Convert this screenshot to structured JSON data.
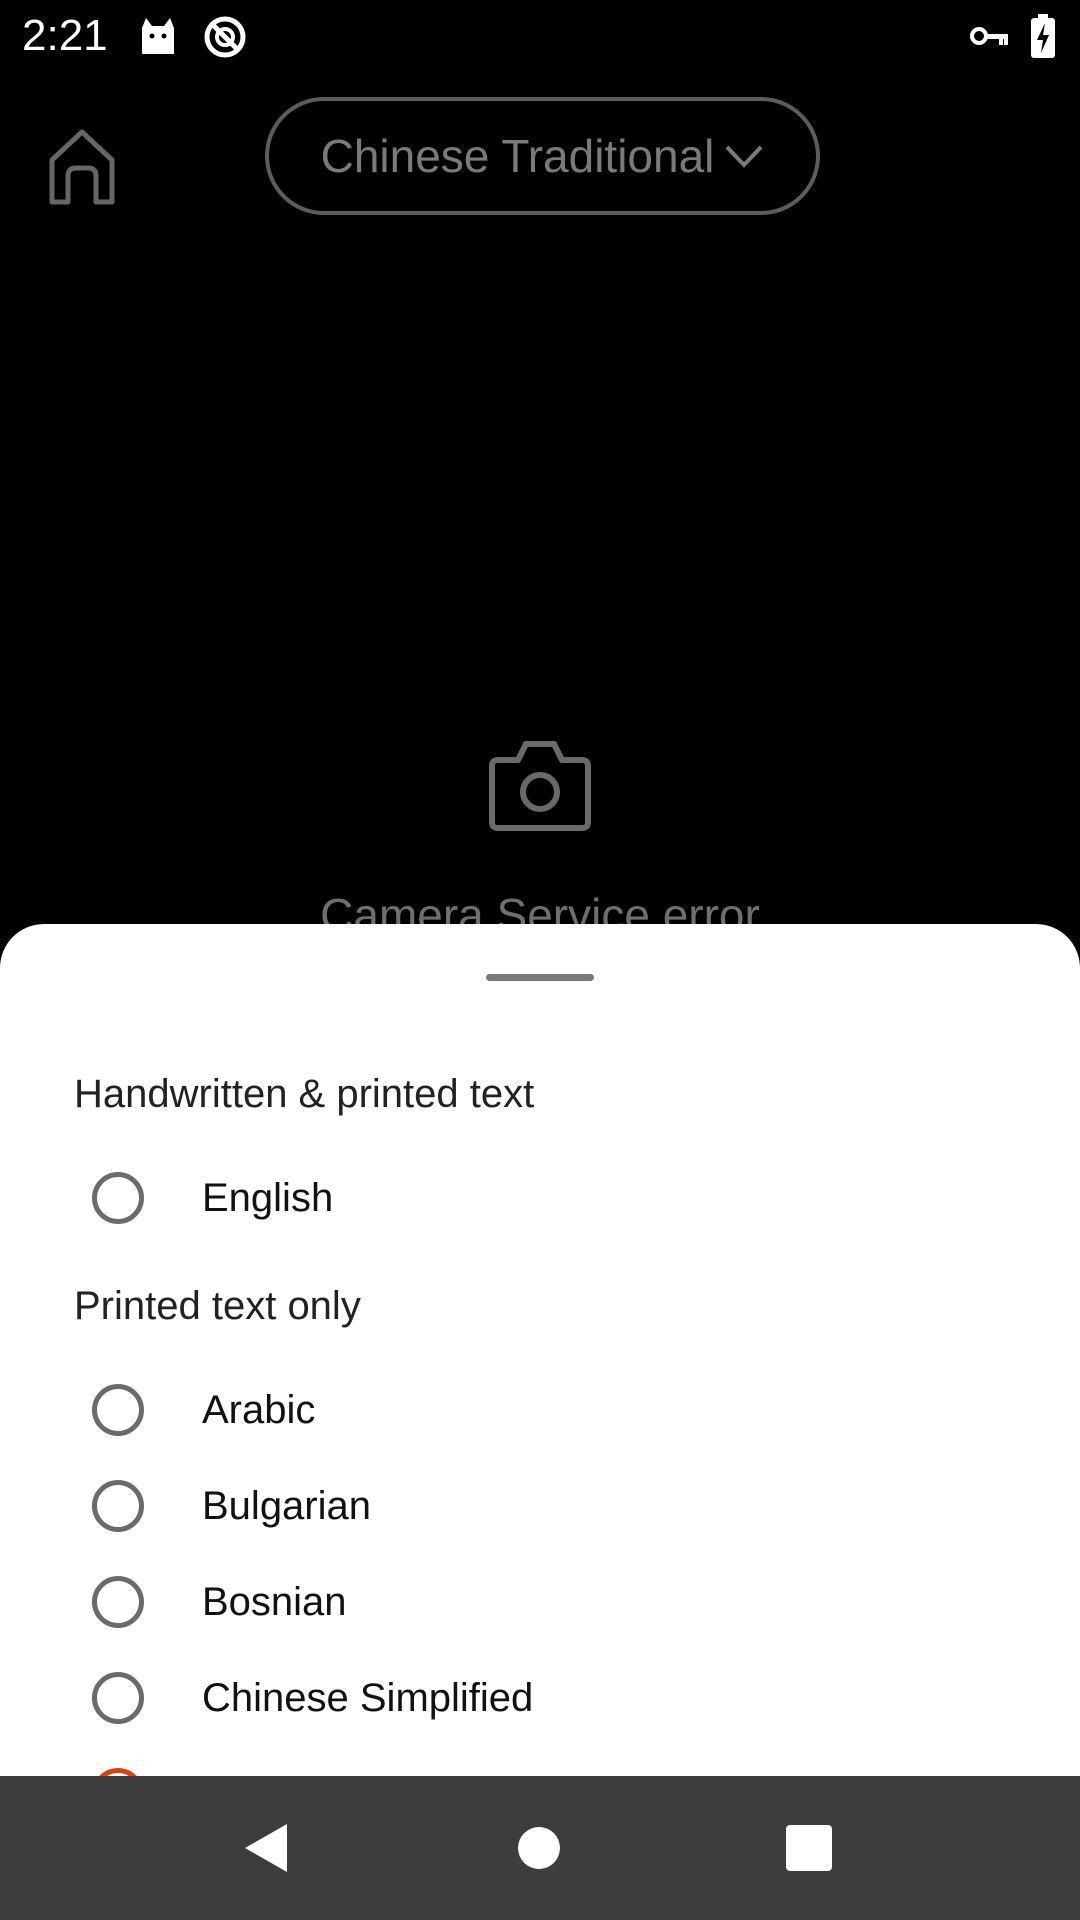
{
  "status_bar": {
    "time": "2:21",
    "icons": [
      "cat-notification-icon",
      "blocked-notification-icon",
      "vpn-key-icon",
      "battery-charging-icon"
    ]
  },
  "top_bar": {
    "home_icon": "home-icon",
    "language_dropdown": {
      "selected": "Chinese Traditional",
      "icon": "chevron-down-icon"
    }
  },
  "camera": {
    "icon": "camera-icon",
    "error_text": "Camera Service error"
  },
  "bottom_sheet": {
    "sections": [
      {
        "header": "Handwritten & printed text",
        "options": [
          {
            "label": "English",
            "selected": false
          }
        ]
      },
      {
        "header": "Printed text only",
        "options": [
          {
            "label": "Arabic",
            "selected": false
          },
          {
            "label": "Bulgarian",
            "selected": false
          },
          {
            "label": "Bosnian",
            "selected": false
          },
          {
            "label": "Chinese Simplified",
            "selected": false
          },
          {
            "label": "",
            "selected": true
          }
        ]
      }
    ]
  },
  "colors": {
    "accent": "#d84315",
    "sheet_background": "#ffffff",
    "nav_bar": "#3d3d3d",
    "background": "#000000"
  },
  "nav_bar": {
    "icons": [
      "back-icon",
      "home-circle-icon",
      "recents-icon"
    ]
  }
}
